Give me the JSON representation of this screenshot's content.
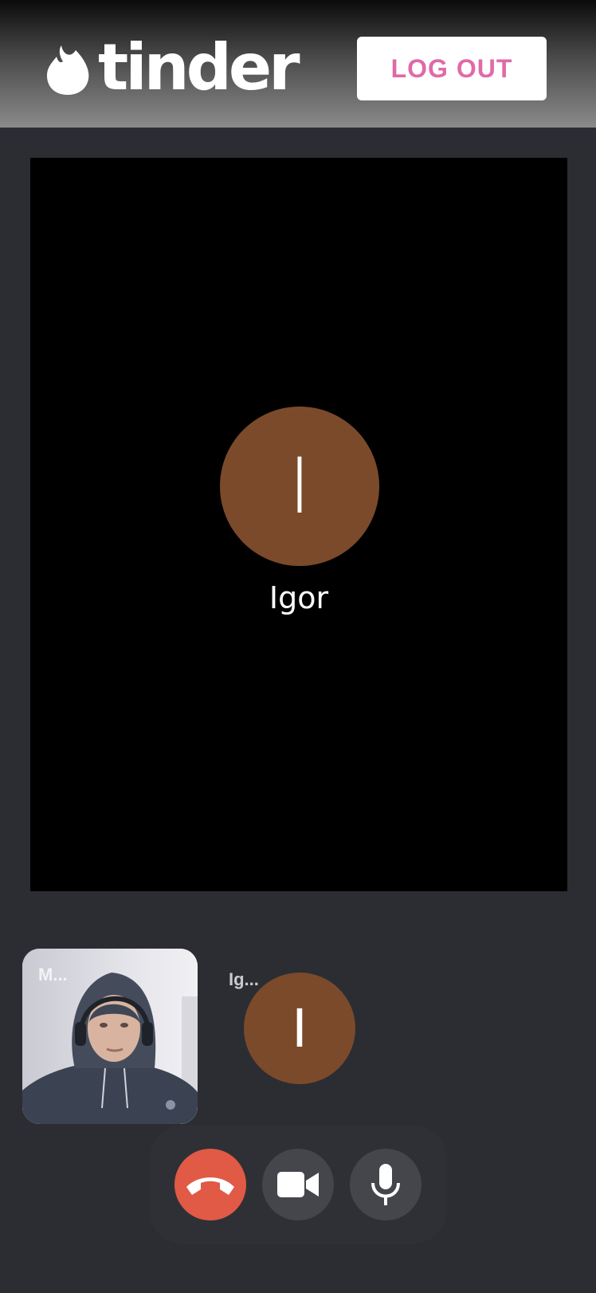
{
  "header": {
    "logo_text": "tinder",
    "logout_label": "LOG OUT"
  },
  "main_video": {
    "avatar_initial": "I",
    "participant_name": "Igor"
  },
  "tiles": {
    "self_label": "M...",
    "peer_label": "Ig...",
    "peer_initial": "I"
  },
  "controls": {
    "hangup_icon": "phone-hangup-icon",
    "camera_icon": "video-camera-icon",
    "mic_icon": "microphone-icon"
  },
  "colors": {
    "brand_pink": "#e06aa8",
    "avatar_brown": "#7b4a2b",
    "hangup_red": "#e05a46",
    "control_gray": "#45464b",
    "background": "#2b2d33"
  }
}
